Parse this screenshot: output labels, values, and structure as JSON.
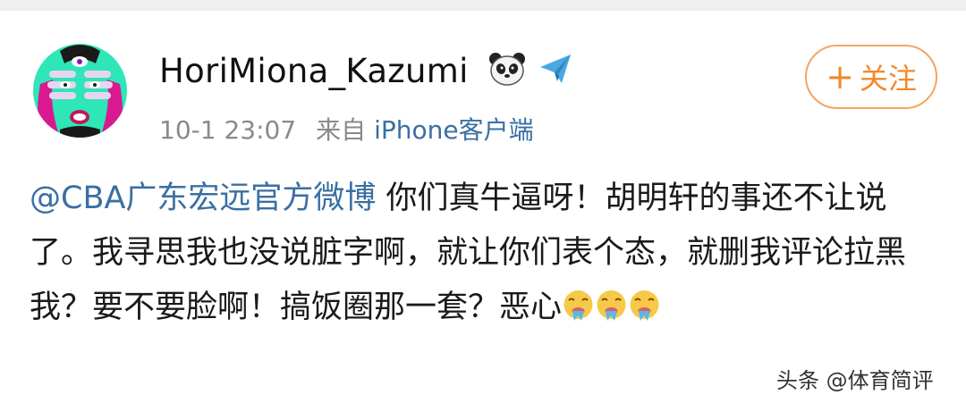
{
  "post": {
    "author": {
      "username": "HoriMiona_Kazumi",
      "badges": [
        "panda-icon",
        "paper-plane-icon"
      ]
    },
    "meta": {
      "time": "10-1 23:07",
      "source_prefix": "来自",
      "source_app": "iPhone客户端"
    },
    "follow_label": "关注",
    "mention": "@CBA广东宏远官方微博",
    "text_part1": " 你们真牛逼呀！胡明轩的事还不让说了。我寻思我也没说脏字啊，就让你们表个态，就删我评论拉黑我？要不要脸啊！搞饭圈那一套？恶心",
    "emojis": [
      "vomiting-face-icon",
      "vomiting-face-icon",
      "vomiting-face-icon"
    ]
  },
  "watermark": "头条 @体育简评",
  "colors": {
    "link": "#3a6fa3",
    "follow_accent": "#f08a2a",
    "meta_gray": "#8a8a8a"
  }
}
